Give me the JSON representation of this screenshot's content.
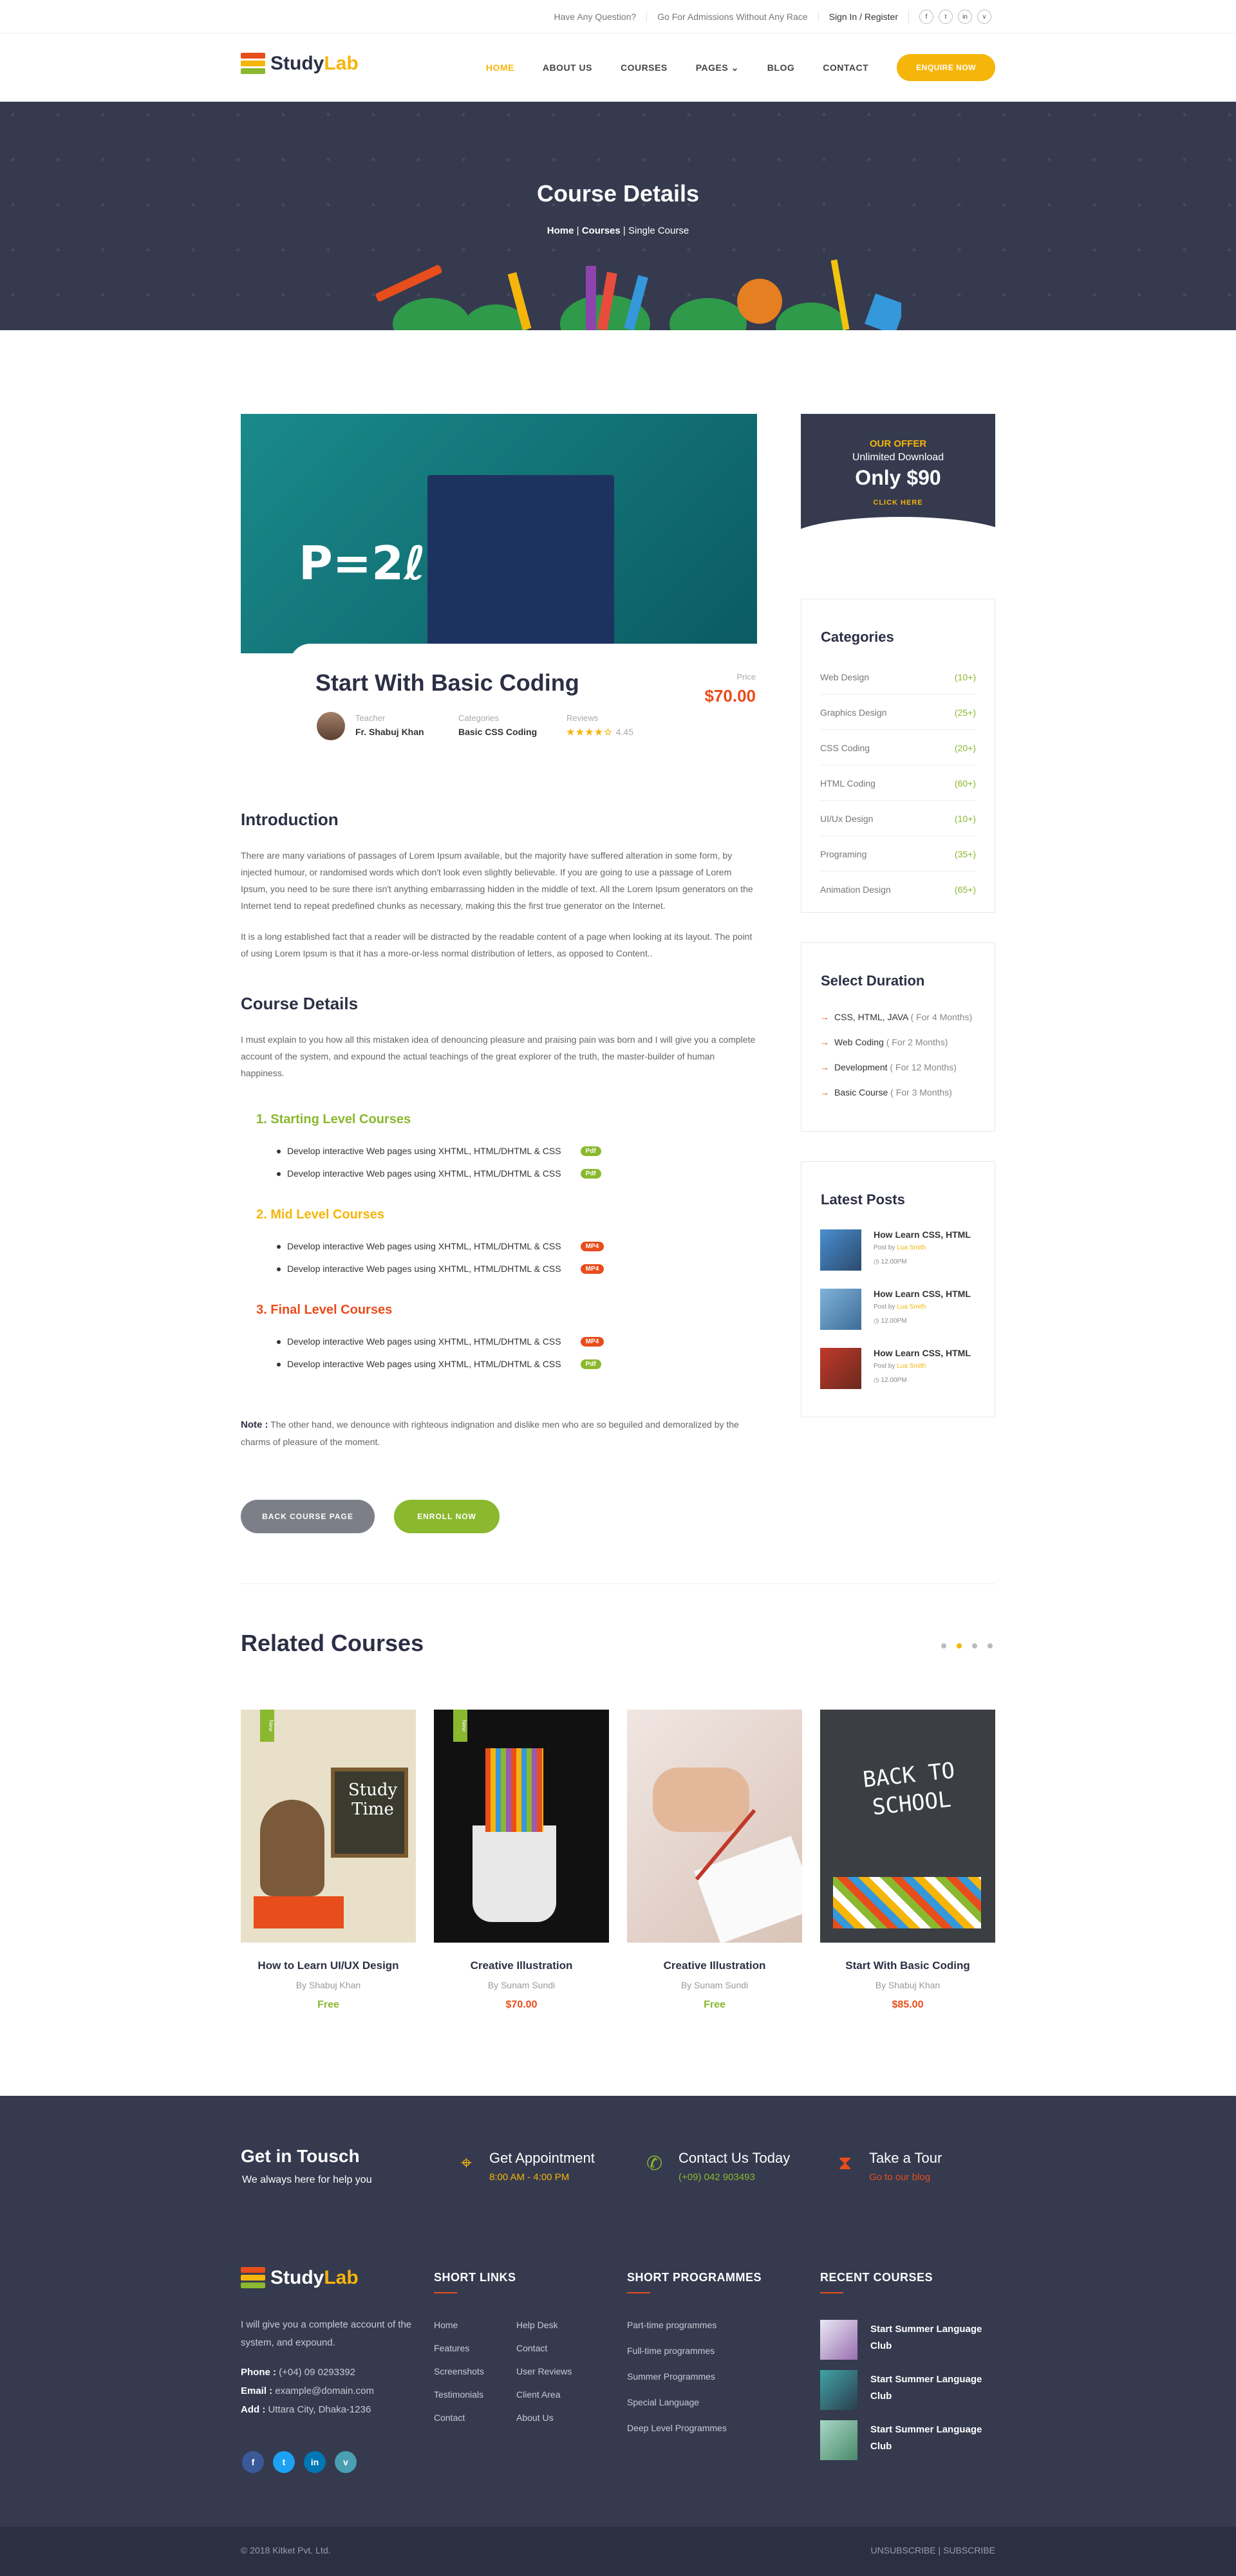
{
  "topbar": {
    "question": "Have Any Question?",
    "admissions": "Go For Admissions Without Any Race",
    "signin": "Sign In / Register",
    "social": [
      "f",
      "t",
      "in",
      "v"
    ]
  },
  "logo": {
    "study": "Study",
    "lab": "Lab"
  },
  "nav": {
    "items": [
      "HOME",
      "ABOUT US",
      "COURSES",
      "PAGES",
      "BLOG",
      "CONTACT"
    ],
    "active": "HOME",
    "enquire": "ENQUIRE NOW"
  },
  "hero": {
    "title": "Course Details",
    "crumb_home": "Home",
    "crumb_courses": "Courses",
    "crumb_current": "Single Course"
  },
  "course": {
    "title": "Start With Basic Coding",
    "price_label": "Price",
    "price": "$70.00",
    "teacher_label": "Teacher",
    "teacher": "Fr. Shabuj Khan",
    "categories_label": "Categories",
    "categories": "Basic CSS Coding",
    "reviews_label": "Reviews",
    "rating": "4.45",
    "formula": "P=2ℓ+"
  },
  "intro": {
    "title": "Introduction",
    "p1": "There are many variations of passages of Lorem Ipsum available, but the majority have suffered alteration in some form, by injected humour, or randomised words which don't look even slightly believable. If you are going to use a passage of Lorem Ipsum, you need to be sure there isn't anything embarrassing hidden in the middle of text. All the Lorem Ipsum generators on the Internet tend to repeat predefined chunks as necessary, making this the first true generator on the Internet.",
    "p2": "It is a long established fact that a reader will be distracted by the readable content of a page when looking at its layout. The point of using Lorem Ipsum is that it has a more-or-less normal distribution of letters, as opposed to Content.."
  },
  "details": {
    "title": "Course Details",
    "p": "I must explain to you how all this mistaken idea of denouncing pleasure and praising pain was born and I will give you a complete account of the system, and expound the actual teachings of the great explorer of the truth, the master-builder of human happiness.",
    "levels": [
      {
        "title": "1. Starting Level Courses",
        "color": "#8ab82e",
        "items": [
          {
            "text": "Develop interactive Web pages using XHTML, HTML/DHTML & CSS",
            "tag": "Pdf",
            "tag_color": "#8ab82e"
          },
          {
            "text": "Develop interactive Web pages using XHTML, HTML/DHTML & CSS",
            "tag": "Pdf",
            "tag_color": "#8ab82e"
          }
        ]
      },
      {
        "title": "2. Mid Level Courses",
        "color": "#f5b50a",
        "items": [
          {
            "text": "Develop interactive Web pages using XHTML, HTML/DHTML & CSS",
            "tag": "MP4",
            "tag_color": "#e84d1c"
          },
          {
            "text": "Develop interactive Web pages using XHTML, HTML/DHTML & CSS",
            "tag": "MP4",
            "tag_color": "#e84d1c"
          }
        ]
      },
      {
        "title": "3. Final Level Courses",
        "color": "#e84d1c",
        "items": [
          {
            "text": "Develop interactive Web pages using XHTML, HTML/DHTML & CSS",
            "tag": "MP4",
            "tag_color": "#e84d1c"
          },
          {
            "text": "Develop interactive Web pages using XHTML, HTML/DHTML & CSS",
            "tag": "Pdf",
            "tag_color": "#8ab82e"
          }
        ]
      }
    ],
    "note_label": "Note :",
    "note": "The other hand, we denounce with righteous indignation and dislike men who are so beguiled and demoralized by the charms of pleasure of the moment.",
    "back_btn": "BACK COURSE PAGE",
    "enroll_btn": "ENROLL NOW"
  },
  "offer": {
    "label": "OUR OFFER",
    "sub": "Unlimited Download",
    "price": "Only $90",
    "cta": "CLICK HERE"
  },
  "categories": {
    "title": "Categories",
    "items": [
      {
        "name": "Web Design",
        "count": "(10+)"
      },
      {
        "name": "Graphics Design",
        "count": "(25+)"
      },
      {
        "name": "CSS Coding",
        "count": "(20+)"
      },
      {
        "name": "HTML Coding",
        "count": "(60+)"
      },
      {
        "name": "UI/Ux Design",
        "count": "(10+)"
      },
      {
        "name": "Programing",
        "count": "(35+)"
      },
      {
        "name": "Animation Design",
        "count": "(65+)"
      }
    ]
  },
  "duration": {
    "title": "Select Duration",
    "items": [
      {
        "name": "CSS, HTML, JAVA",
        "dur": "( For 4 Months)"
      },
      {
        "name": "Web Coding",
        "dur": "( For 2 Months)"
      },
      {
        "name": "Development",
        "dur": "( For 12 Months)"
      },
      {
        "name": "Basic Course",
        "dur": "( For 3 Months)"
      }
    ]
  },
  "posts": {
    "title": "Latest Posts",
    "items": [
      {
        "title": "How Learn CSS, HTML",
        "by": "Post by",
        "author": "Lua Smith",
        "date": "◷ 12.00PM"
      },
      {
        "title": "How Learn CSS, HTML",
        "by": "Post by",
        "author": "Lua Smith",
        "date": "◷ 12.00PM"
      },
      {
        "title": "How Learn CSS, HTML",
        "by": "Post by",
        "author": "Lua Smith",
        "date": "◷ 12.00PM"
      }
    ]
  },
  "related": {
    "title": "Related Courses",
    "items": [
      {
        "title": "How to Learn UI/UX Design",
        "author": "By Shabuj Khan",
        "price": "Free",
        "price_color": "#8ab82e",
        "ribbon": "New",
        "art": "Study Time"
      },
      {
        "title": "Creative Illustration",
        "author": "By Sunam Sundi",
        "price": "$70.00",
        "price_color": "#e84d1c",
        "ribbon": "New",
        "art": ""
      },
      {
        "title": "Creative Illustration",
        "author": "By Sunam Sundi",
        "price": "Free",
        "price_color": "#8ab82e",
        "ribbon": "",
        "art": ""
      },
      {
        "title": "Start With Basic Coding",
        "author": "By Shabuj Khan",
        "price": "$85.00",
        "price_color": "#e84d1c",
        "ribbon": "",
        "art": "BACK TO SCHOOL"
      }
    ]
  },
  "footer": {
    "touch_title": "Get in Tousch",
    "touch_sub": "We always here for help you",
    "appt_title": "Get Appointment",
    "appt_sub": "8:00 AM - 4:00 PM",
    "contact_title": "Contact Us Today",
    "contact_sub": "(+09) 042 903493",
    "tour_title": "Take a Tour",
    "tour_sub": "Go to our blog",
    "about": "I will give you a complete account of the system, and expound.",
    "phone_label": "Phone :",
    "phone": "(+04) 09 0293392",
    "email_label": "Email :",
    "email": "example@domain.com",
    "add_label": "Add :",
    "add": "Uttara City, Dhaka-1236",
    "social": [
      "f",
      "t",
      "in",
      "v"
    ],
    "short_links_title": "SHORT LINKS",
    "links_a": [
      "Home",
      "Features",
      "Screenshots",
      "Testimonials",
      "Contact"
    ],
    "links_b": [
      "Help Desk",
      "Contact",
      "User Reviews",
      "Client Area",
      "About Us"
    ],
    "programmes_title": "SHORT PROGRAMMES",
    "programmes": [
      "Part-time programmes",
      "Full-time programmes",
      "Summer Programmes",
      "Special Language",
      "Deep Level Programmes"
    ],
    "recent_title": "RECENT COURSES",
    "recent": [
      "Start Summer Language Club",
      "Start Summer Language Club",
      "Start Summer Language Club"
    ],
    "copyright": "© 2018 Kitket Pvt. Ltd.",
    "unsubscribe": "UNSUBSCRIBE",
    "subscribe": "SUBSCRIBE"
  },
  "colors": {
    "accent": "#f5b50a",
    "green": "#8ab82e",
    "orange": "#e84d1c",
    "dark": "#353a4f"
  }
}
